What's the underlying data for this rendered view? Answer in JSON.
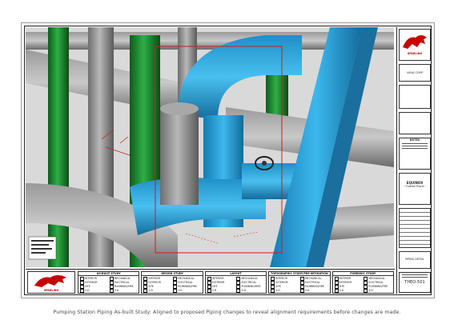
{
  "caption": "Pumping Station Piping As-built Study: Aligned to proposed Piping changes to reveal alignment requirements before changes are made.",
  "title_block": {
    "logo_text": "SPARLING",
    "company_line1": "NOVA CORP",
    "notes_header": "NOTES",
    "project_title": "EQUINOX",
    "project_subtitle": "~Outfall Plant~",
    "drawing_name": "PIPING DETAIL",
    "drawing_number": "THEO-501"
  },
  "logo_brand": "SPARLING",
  "checkbox_groups": [
    {
      "title": "AS-BUILT STUDY",
      "items": [
        "INTERIOR",
        "MECHANICAL",
        "EXTERIOR",
        "ELECTRICAL",
        "SITE",
        "PLUMBING/FIRE",
        "2-D",
        "3-D"
      ]
    },
    {
      "title": "DESIGN STUDY",
      "items": [
        "INTERIOR",
        "MECHANICAL",
        "EXTERIOR",
        "ELECTRICAL",
        "SITE",
        "PLUMBING/FIRE",
        "2-D",
        "3-D"
      ]
    },
    {
      "title": "LAYOUT",
      "items": [
        "INTERIOR",
        "MECHANICAL",
        "EXTERIOR",
        "ELECTRICAL",
        "SITE",
        "PLUMBING/FIRE",
        "2-D",
        "3-D"
      ]
    },
    {
      "title": "TOPOGRAPHIC STUDY/PRE MITIGATION",
      "items": [
        "INTERIOR",
        "MECHANICAL",
        "EXTERIOR",
        "ELECTRICAL",
        "SITE",
        "PLUMBING/FIRE",
        "2-D",
        "3-D"
      ]
    },
    {
      "title": "FORENSIC STUDY",
      "items": [
        "INTERIOR",
        "MECHANICAL",
        "EXTERIOR",
        "ELECTRICAL",
        "SITE",
        "PLUMBING/FIRE",
        "2-D",
        "3-D"
      ]
    }
  ],
  "colors": {
    "pipe_blue": "#2a9fd6",
    "pipe_green": "#1f8a2e",
    "pipe_gray": "#8c8c8c",
    "markup_red": "#d11a1a",
    "logo_red": "#c80000"
  }
}
